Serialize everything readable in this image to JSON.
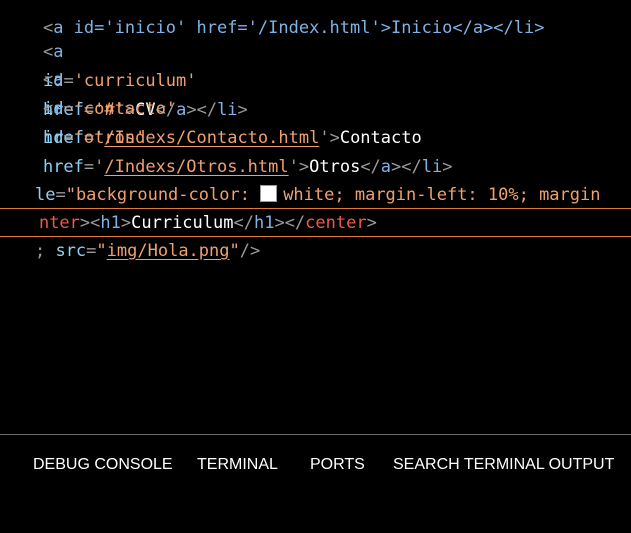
{
  "editor": {
    "line0": {
      "a": "a id='inicio' href='/Index.html'>Inicio</a></li>"
    },
    "line1": {
      "open": "<",
      "tag": "a",
      "attr1": "id",
      "eq1": "=",
      "val1": "'curriculum'",
      "attr2": "href",
      "eq2": "=",
      "val2": "'#'",
      "gt": ">",
      "text": "CV",
      "close": "</",
      "ctag": "a",
      "cclose": "></",
      "ltag": "li",
      "end": ">"
    },
    "line2": {
      "open": "<",
      "tag": "a",
      "attr1": "id",
      "eq1": "=",
      "val1": "'contacto'",
      "attr2": "href",
      "eq2": "='",
      "link": "/Indexs/Contacto.html",
      "q": "'",
      "gt": ">",
      "text": "Contacto"
    },
    "line3": {
      "open": "<",
      "tag": "a",
      "attr1": "id",
      "eq1": "=",
      "val1": "'otros'",
      "attr2": "href",
      "eq2": "='",
      "link": "/Indexs/Otros.html",
      "q": "'",
      "gt": ">",
      "text": "Otros",
      "close": "</",
      "ctag": "a",
      "cclose": "></",
      "ltag": "li",
      "end": ">"
    },
    "line5": {
      "attr": "le",
      "eq": "=",
      "q1": "\"",
      "prop1": "background-color:",
      "swatch_color": "#ffffff",
      "val1": "white",
      "rest": "; margin-left: 10%; margin"
    },
    "line6": {
      "ctag1": "nter",
      "gt1": "><",
      "h1": "h1",
      "gt2": ">",
      "text": "Curriculum",
      "cl1": "</",
      "h1c": "h1",
      "cl2": "></",
      "ctag2": "center",
      "gt3": ">"
    },
    "line7": {
      "semi": ";",
      "attr": "src",
      "eq": "=",
      "q1": "\"",
      "link": "img/Hola.png",
      "q2": "\"",
      "end": "/>"
    }
  },
  "panel": {
    "tabs": [
      "DEBUG CONSOLE",
      "TERMINAL",
      "PORTS",
      "SEARCH TERMINAL OUTPUT"
    ]
  }
}
